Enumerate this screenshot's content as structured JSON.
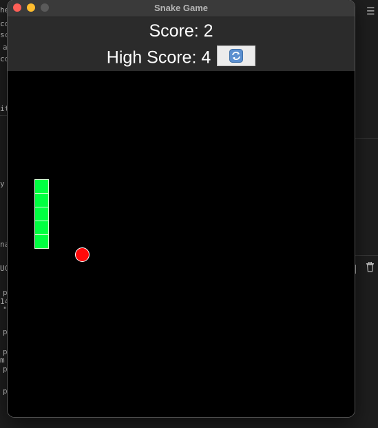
{
  "window": {
    "title": "Snake Game"
  },
  "header": {
    "score": "Score: 2",
    "high_score": "High Score: 4"
  },
  "reset_button": {
    "icon": "refresh-icon"
  },
  "game": {
    "snake_color": "#00ff41",
    "food_color": "#ff0a0a",
    "board_color": "#000000"
  },
  "background": {
    "fragments": [
      "he",
      "co",
      "sc",
      "a",
      "co",
      "it",
      "y",
      "na",
      "UC",
      "p",
      "14",
      "\"",
      "p",
      "p",
      "m",
      "p",
      "p"
    ]
  },
  "colors": {
    "titlebar": "#3a3a3a",
    "header": "#2b2b2b"
  }
}
